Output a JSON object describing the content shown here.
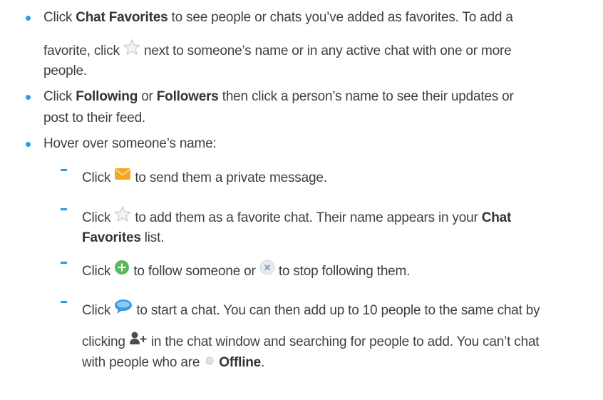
{
  "bullets": [
    {
      "lines": [
        {
          "pre": "Click ",
          "bold": "Chat Favorites",
          "post": "  to see people or chats you’ve added as favorites. To add a"
        },
        {
          "pre": "favorite, click ",
          "post": " next to someone’s name or in any active chat with one or more"
        },
        {
          "text": "people."
        }
      ]
    },
    {
      "lines": [
        {
          "pre": "Click ",
          "bold": "Following",
          "mid": " or ",
          "bold2": "Followers",
          "post": " then click a person’s name to see their updates or"
        },
        {
          "text": "post to their feed."
        }
      ]
    },
    {
      "lines": [
        {
          "text": "Hover over someone’s name:"
        }
      ]
    }
  ],
  "sub_items": [
    {
      "lines": [
        {
          "pre": "Click ",
          "post": " to send them a private message."
        }
      ]
    },
    {
      "lines": [
        {
          "pre": "Click ",
          "post": " to add them as a favorite chat. Their name appears in your ",
          "bold": "Chat"
        },
        {
          "bold": "Favorites",
          "post": "  list."
        }
      ]
    },
    {
      "lines": [
        {
          "pre": "Click ",
          "mid": " to follow someone or ",
          "post": " to stop following them."
        }
      ]
    },
    {
      "lines": [
        {
          "pre": "Click ",
          "post": " to start a chat. You can then add up to 10 people to the same chat by"
        },
        {
          "pre": "clicking ",
          "post": " in the chat window and searching for people to add. You can’t chat"
        },
        {
          "pre": "with people who are ",
          "bold": "Offline",
          "post": "."
        }
      ]
    }
  ],
  "icons": {
    "star": "star-icon",
    "envelope": "envelope-icon",
    "follow": "follow-plus-icon",
    "unfollow": "unfollow-x-icon",
    "chat": "chat-bubble-icon",
    "add_person": "add-person-icon",
    "offline": "offline-status-icon"
  },
  "colors": {
    "bullet": "#2a9ee0",
    "text": "#3f3f3f",
    "envelope": "#f5a623",
    "follow": "#5cb85c",
    "chat": "#3a9de0"
  }
}
